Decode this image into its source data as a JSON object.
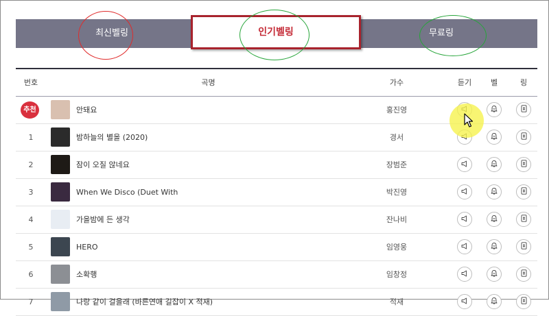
{
  "tabs": {
    "latest": "최신벨링",
    "popular": "인기벨링",
    "free": "무료링"
  },
  "table": {
    "headers": {
      "num": "번호",
      "title": "곡명",
      "artist": "가수",
      "listen": "듣기",
      "bell": "벨",
      "ring": "링"
    },
    "rows": [
      {
        "num": "추천",
        "title": "안돼요",
        "artist": "홍진영",
        "thumb_color": "#d9c0b0"
      },
      {
        "num": "1",
        "title": "밤하늘의 별을 (2020)",
        "artist": "경서",
        "thumb_color": "#2b2b2b"
      },
      {
        "num": "2",
        "title": "잠이 오질 않네요",
        "artist": "장범준",
        "thumb_color": "#1e1a16"
      },
      {
        "num": "3",
        "title": "When We Disco (Duet With",
        "artist": "박진영",
        "thumb_color": "#3a2a40"
      },
      {
        "num": "4",
        "title": "가을밤에 든 생각",
        "artist": "잔나비",
        "thumb_color": "#e8edf3"
      },
      {
        "num": "5",
        "title": "HERO",
        "artist": "임영웅",
        "thumb_color": "#3c4650"
      },
      {
        "num": "6",
        "title": "소확행",
        "artist": "임창정",
        "thumb_color": "#8c8f94"
      },
      {
        "num": "7",
        "title": "나랑 같이 걸을래 (바른연애 길잡이 X 적재)",
        "artist": "적재",
        "thumb_color": "#8f9aa6"
      }
    ]
  },
  "colors": {
    "tab_bg": "#757588",
    "active_border": "#a8232d",
    "active_text": "#c42a36",
    "badge": "#d9303e"
  }
}
